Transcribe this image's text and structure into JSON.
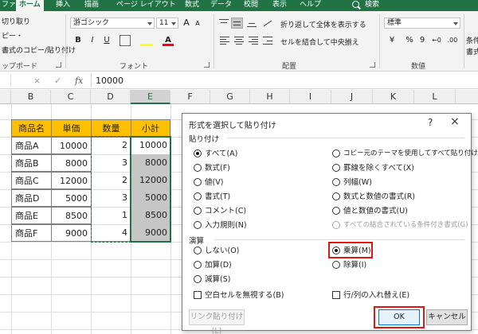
{
  "ribbon": {
    "tabs": [
      "ファイル",
      "ホーム",
      "挿入",
      "描画",
      "ページ レイアウト",
      "数式",
      "データ",
      "校閲",
      "表示",
      "ヘルプ",
      "検索"
    ],
    "active_tab": "ホーム",
    "clipboard": {
      "cut": "切り取り",
      "copy": "ピー・",
      "format_painter": "書式のコピー/貼り付け",
      "group_label": "ップボード"
    },
    "font": {
      "name": "游ゴシック",
      "size": "11",
      "grow": "A",
      "shrink": "A",
      "bold": "B",
      "italic": "I",
      "underline": "U",
      "group_label": "フォント"
    },
    "alignment": {
      "wrap": "折り返して全体を表示する",
      "merge": "セルを結合して中央揃え",
      "group_label": "配置"
    },
    "number": {
      "format": "標準",
      "percent": "%",
      "comma": "9",
      "group_label": "数値"
    },
    "styles": {
      "conditional": "条件付",
      "conditional_sub": "書式"
    }
  },
  "formula_bar": {
    "name_box": "",
    "value": "10000",
    "cancel": "×",
    "enter": "✓",
    "fx": "fx"
  },
  "grid": {
    "columns": [
      "B",
      "C",
      "D",
      "E",
      "F",
      "G",
      "H",
      "I",
      "J",
      "K",
      "L"
    ],
    "selected_column": "E",
    "headers": [
      "商品名",
      "単価",
      "数量",
      "小計"
    ],
    "rows": [
      {
        "name": "商品A",
        "price": "10000",
        "qty": "2",
        "subtotal": "10000"
      },
      {
        "name": "商品B",
        "price": "8000",
        "qty": "3",
        "subtotal": "8000"
      },
      {
        "name": "商品C",
        "price": "12000",
        "qty": "2",
        "subtotal": "12000"
      },
      {
        "name": "商品D",
        "price": "5000",
        "qty": "3",
        "subtotal": "5000"
      },
      {
        "name": "商品E",
        "price": "8500",
        "qty": "1",
        "subtotal": "8500"
      },
      {
        "name": "商品F",
        "price": "9000",
        "qty": "4",
        "subtotal": "9000"
      }
    ]
  },
  "dialog": {
    "title": "形式を選択して貼り付け",
    "help": "?",
    "close": "×",
    "paste_section": "貼り付け",
    "paste_left": [
      "すべて(A)",
      "数式(F)",
      "値(V)",
      "書式(T)",
      "コメント(C)",
      "入力規則(N)"
    ],
    "paste_right": [
      "コピー元のテーマを使用してすべて貼り付け(H)",
      "罫線を除くすべて(X)",
      "列幅(W)",
      "数式と数値の書式(R)",
      "値と数値の書式(U)",
      "すべての結合されている条件付き書式(G)"
    ],
    "paste_selected": "すべて(A)",
    "operation_section": "演算",
    "operation_left": [
      "しない(O)",
      "加算(D)",
      "減算(S)"
    ],
    "operation_right": [
      "乗算(M)",
      "除算(I)"
    ],
    "operation_selected": "乗算(M)",
    "skip_blanks": "空白セルを無視する(B)",
    "transpose": "行/列の入れ替え(E)",
    "paste_link": "リンク貼り付け(L)",
    "ok": "OK",
    "cancel": "キャンセル"
  },
  "colors": {
    "accent": "#217346",
    "header_fill": "#ffc000",
    "highlight": "#e31414",
    "selection_fill": "#c6c6c6"
  }
}
